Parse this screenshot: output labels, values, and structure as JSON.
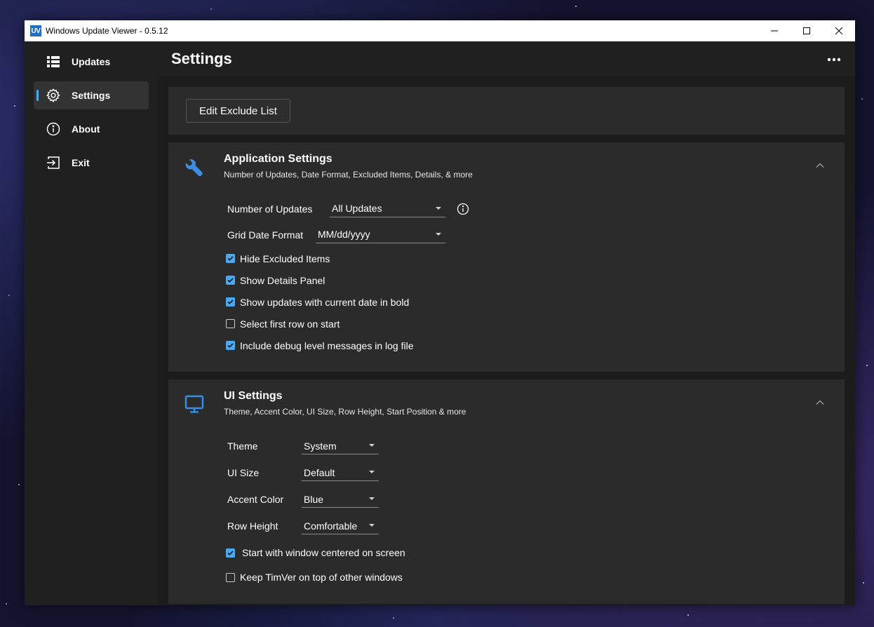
{
  "window": {
    "title": "Windows Update Viewer - 0.5.12",
    "app_icon_text": "UV"
  },
  "sidebar": {
    "items": [
      {
        "label": "Updates",
        "icon": "list-icon",
        "active": false
      },
      {
        "label": "Settings",
        "icon": "gear-icon",
        "active": true
      },
      {
        "label": "About",
        "icon": "info-icon",
        "active": false
      },
      {
        "label": "Exit",
        "icon": "exit-icon",
        "active": false
      }
    ]
  },
  "header": {
    "title": "Settings"
  },
  "exclude": {
    "button_label": "Edit Exclude List"
  },
  "app_settings": {
    "title": "Application Settings",
    "subtitle": "Number of Updates, Date Format, Excluded Items, Details, & more",
    "icon": "wrench-icon",
    "number_of_updates": {
      "label": "Number of Updates",
      "value": "All Updates"
    },
    "grid_date_format": {
      "label": "Grid Date Format",
      "value": "MM/dd/yyyy"
    },
    "checks": [
      {
        "label": "Hide Excluded Items",
        "checked": true
      },
      {
        "label": "Show Details Panel",
        "checked": true
      },
      {
        "label": "Show updates with current date in bold",
        "checked": true
      },
      {
        "label": "Select first row on start",
        "checked": false
      },
      {
        "label": "Include debug level messages in log file",
        "checked": true
      }
    ]
  },
  "ui_settings": {
    "title": "UI Settings",
    "subtitle": "Theme, Accent Color, UI Size, Row Height, Start Position & more",
    "icon": "monitor-icon",
    "theme": {
      "label": "Theme",
      "value": "System"
    },
    "ui_size": {
      "label": "UI Size",
      "value": "Default"
    },
    "accent_color": {
      "label": "Accent Color",
      "value": "Blue"
    },
    "row_height": {
      "label": "Row Height",
      "value": "Comfortable"
    },
    "checks": [
      {
        "label": "Start with window centered on screen",
        "checked": true
      },
      {
        "label": "Keep TimVer on top of other windows",
        "checked": false
      }
    ]
  },
  "colors": {
    "accent": "#4ca8ef",
    "icon_blue": "#3a8ee6"
  }
}
